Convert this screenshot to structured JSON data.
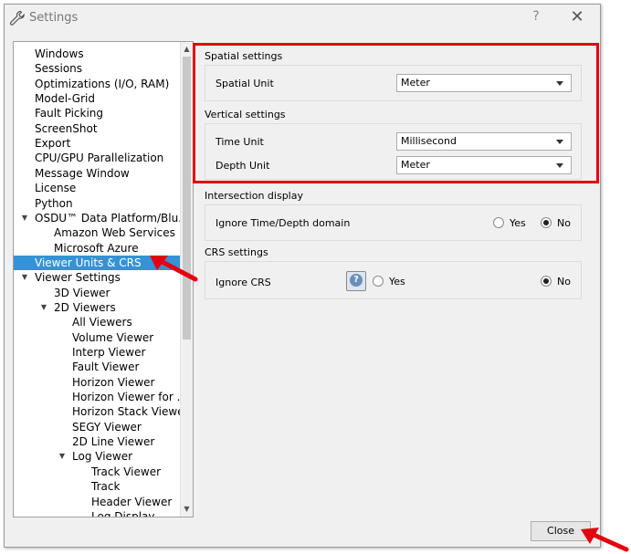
{
  "window": {
    "title": "Settings",
    "help": "?",
    "close": "✕"
  },
  "tree": {
    "items": [
      {
        "label": "Windows",
        "level": 1
      },
      {
        "label": "Sessions",
        "level": 1
      },
      {
        "label": "Optimizations (I/O, RAM)",
        "level": 1
      },
      {
        "label": "Model-Grid",
        "level": 1
      },
      {
        "label": "Fault Picking",
        "level": 1
      },
      {
        "label": "ScreenShot",
        "level": 1
      },
      {
        "label": "Export",
        "level": 1
      },
      {
        "label": "CPU/GPU Parallelization",
        "level": 1
      },
      {
        "label": "Message Window",
        "level": 1
      },
      {
        "label": "License",
        "level": 1
      },
      {
        "label": "Python",
        "level": 1
      },
      {
        "label": "OSDU™ Data Platform/Blu...",
        "level": 1,
        "expanded": true
      },
      {
        "label": "Amazon Web Services",
        "level": 2
      },
      {
        "label": "Microsoft Azure",
        "level": 2
      },
      {
        "label": "Viewer Units & CRS",
        "level": 1,
        "selected": true
      },
      {
        "label": "Viewer Settings",
        "level": 1,
        "expanded": true
      },
      {
        "label": "3D Viewer",
        "level": 2
      },
      {
        "label": "2D Viewers",
        "level": 2,
        "expanded": true
      },
      {
        "label": "All Viewers",
        "level": 3
      },
      {
        "label": "Volume Viewer",
        "level": 3
      },
      {
        "label": "Interp Viewer",
        "level": 3
      },
      {
        "label": "Fault Viewer",
        "level": 3
      },
      {
        "label": "Horizon Viewer",
        "level": 3
      },
      {
        "label": "Horizon Viewer for ...",
        "level": 3
      },
      {
        "label": "Horizon Stack Viewer",
        "level": 3
      },
      {
        "label": "SEGY Viewer",
        "level": 3
      },
      {
        "label": "2D Line Viewer",
        "level": 3
      },
      {
        "label": "Log Viewer",
        "level": 3,
        "expanded": true
      },
      {
        "label": "Track Viewer",
        "level": 4
      },
      {
        "label": "Track",
        "level": 4
      },
      {
        "label": "Header Viewer",
        "level": 4
      },
      {
        "label": "Log Display",
        "level": 4
      }
    ]
  },
  "spatial": {
    "title": "Spatial settings",
    "unit_label": "Spatial Unit",
    "unit_value": "Meter"
  },
  "vertical": {
    "title": "Vertical settings",
    "time_label": "Time Unit",
    "time_value": "Millisecond",
    "depth_label": "Depth Unit",
    "depth_value": "Meter"
  },
  "intersection": {
    "title": "Intersection display",
    "ignore_label": "Ignore Time/Depth domain",
    "yes": "Yes",
    "no": "No",
    "selected": "No"
  },
  "crs": {
    "title": "CRS settings",
    "ignore_label": "Ignore CRS",
    "yes": "Yes",
    "no": "No",
    "selected": "No"
  },
  "footer": {
    "close_label": "Close"
  },
  "colors": {
    "selection": "#3593d5",
    "highlight": "#e3000f"
  }
}
